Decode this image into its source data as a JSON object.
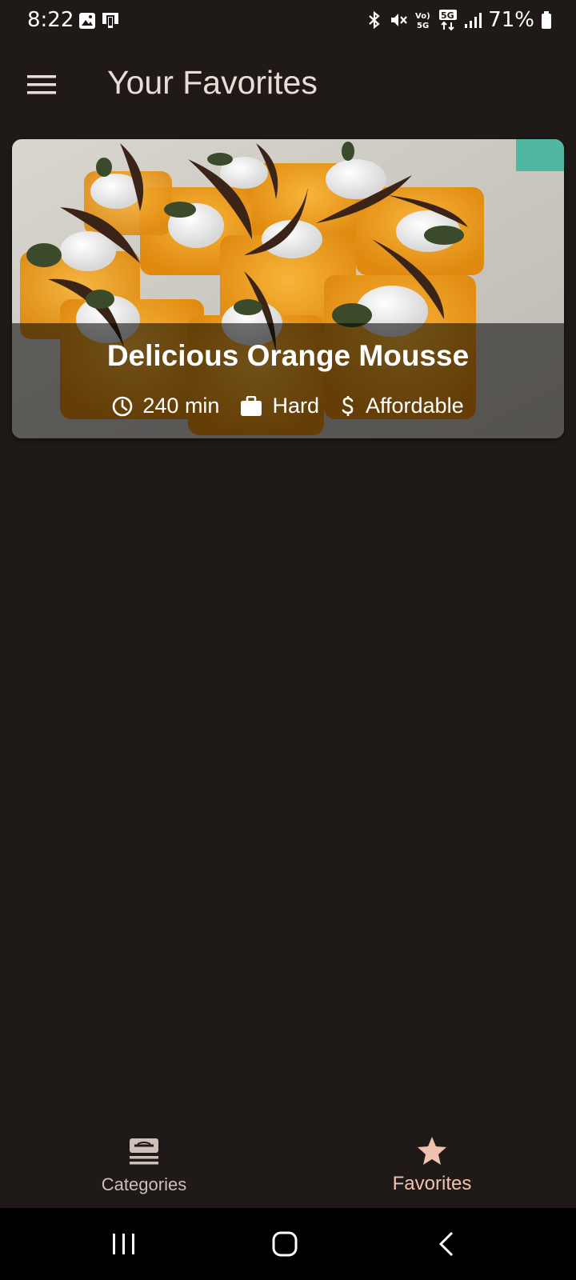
{
  "status_bar": {
    "time": "8:22",
    "battery": "71%",
    "icons": [
      "image-icon",
      "device-icon",
      "bluetooth-icon",
      "mute-icon",
      "volte-icon",
      "5g-icon",
      "signal-icon",
      "battery-icon"
    ]
  },
  "app_bar": {
    "title": "Your Favorites",
    "menu_icon": "hamburger-menu-icon"
  },
  "favorites": [
    {
      "title": "Delicious Orange Mousse",
      "duration": "240 min",
      "complexity": "Hard",
      "affordability": "Affordable",
      "icons": {
        "duration": "clock-icon",
        "complexity": "briefcase-icon",
        "affordability": "dollar-icon"
      }
    }
  ],
  "bottom_nav": {
    "items": [
      {
        "label": "Categories",
        "icon": "categories-icon",
        "selected": false
      },
      {
        "label": "Favorites",
        "icon": "star-icon",
        "selected": true
      }
    ],
    "selected_color": "#f0c2ad"
  },
  "system_nav": {
    "buttons": [
      "recents-icon",
      "home-icon",
      "back-icon"
    ]
  },
  "colors": {
    "background": "#1f1a17",
    "title": "#eadcd6",
    "accent": "#f0c2ad"
  }
}
